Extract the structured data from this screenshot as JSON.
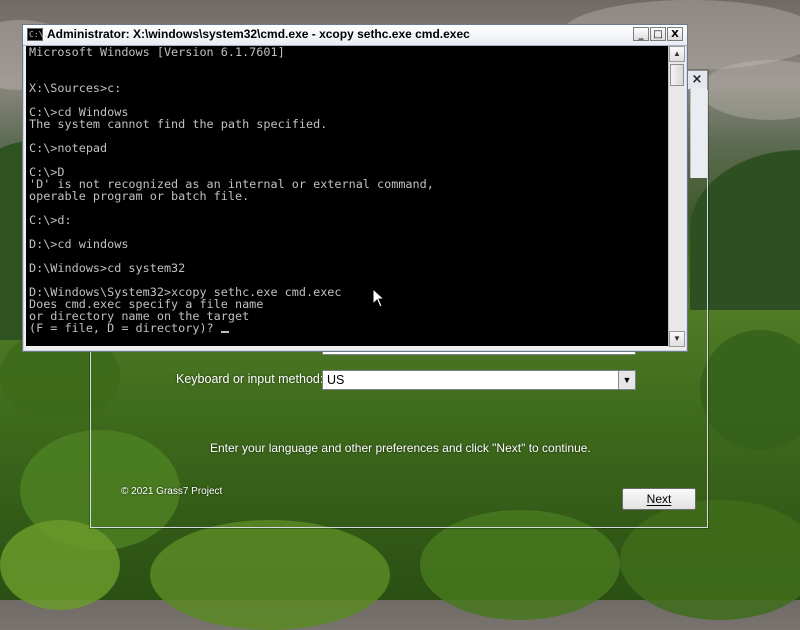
{
  "cmd_window": {
    "title": "Administrator: X:\\windows\\system32\\cmd.exe - xcopy  sethc.exe cmd.exec",
    "minimize_glyph": "_",
    "maximize_glyph": "□",
    "close_glyph": "X",
    "icon_text": "C:\\.",
    "lines": [
      "Microsoft Windows [Version 6.1.7601]",
      "",
      "",
      "X:\\Sources>c:",
      "",
      "C:\\>cd Windows",
      "The system cannot find the path specified.",
      "",
      "C:\\>notepad",
      "",
      "C:\\>D",
      "'D' is not recognized as an internal or external command,",
      "operable program or batch file.",
      "",
      "C:\\>d:",
      "",
      "D:\\>cd windows",
      "",
      "D:\\Windows>cd system32",
      "",
      "D:\\Windows\\System32>xcopy sethc.exe cmd.exec",
      "Does cmd.exec specify a file name",
      "or directory name on the target",
      "(F = file, D = directory)? "
    ]
  },
  "setup_window": {
    "close_glyph": "×",
    "keyboard_label": "Keyboard or input method:",
    "keyboard_value": "US",
    "instruction": "Enter your language and other preferences and click \"Next\" to continue.",
    "copyright": "© 2021 Grass7 Project",
    "next_label": "Next"
  },
  "colors": {
    "console_bg": "#000000",
    "console_text": "#c0c0c0"
  }
}
